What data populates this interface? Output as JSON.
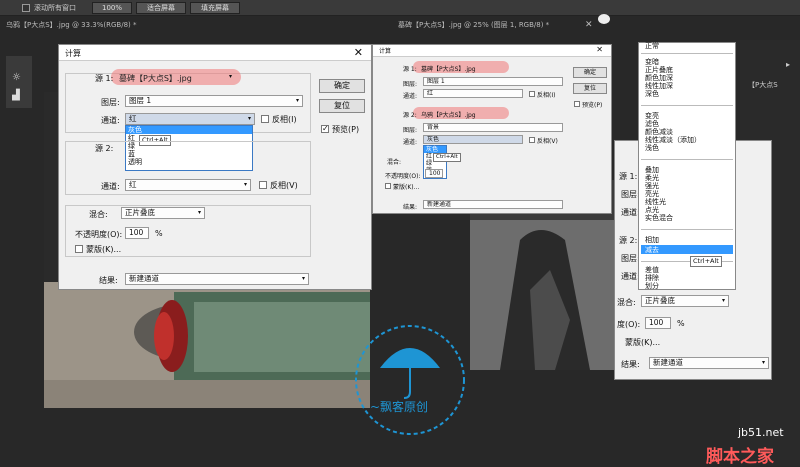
{
  "topbar": {
    "checkbox_label": "滚动所有窗口",
    "zoom_btn": "100%",
    "fit_btn": "适合屏幕",
    "fill_btn": "填充屏幕"
  },
  "tabs": {
    "left": "乌鸦【P大点S】.jpg @ 33.3%(RGB/8) *",
    "right": "墓碑【P大点S】.jpg @ 25% (图层 1, RGB/8) *"
  },
  "calc_big": {
    "title": "计算",
    "source1_label": "源 1:",
    "source1_value": "墓碑【P大点S】.jpg",
    "layer_label": "图层:",
    "layer_value": "图层 1",
    "channel_label": "通道:",
    "channel_value": "红",
    "invert_label": "反相(I)",
    "channel_options": [
      "灰色",
      "红",
      "绿",
      "蓝",
      "透明"
    ],
    "tooltip": "Ctrl+Alt",
    "source2_label": "源 2:",
    "channel2_label": "通道:",
    "channel2_value": "红",
    "invert2_label": "反相(V)",
    "blend_label": "混合:",
    "blend_value": "正片叠底",
    "opacity_label": "不透明度(O):",
    "opacity_value": "100",
    "opacity_unit": "%",
    "mask_label": "蒙版(K)...",
    "result_label": "结果:",
    "result_value": "新建通道",
    "ok_btn": "确定",
    "reset_btn": "复位",
    "preview_label": "预览(P)"
  },
  "calc_small": {
    "title": "计算",
    "source1_label": "源 1:",
    "source1_value": "墓碑【P大点S】.jpg",
    "layer_label": "图层:",
    "layer_value": "图层 1",
    "channel_label": "通道:",
    "channel_value": "红",
    "invert_label": "反相(I)",
    "source2_label": "源 2:",
    "source2_value": "乌鸦【P大点S】.jpg",
    "layer2_label": "图层:",
    "layer2_value": "背景",
    "channel2_label": "通道:",
    "channel2_value": "灰色",
    "invert2_label": "反相(V)",
    "channel_options": [
      "灰色",
      "红",
      "绿",
      "蓝"
    ],
    "tooltip": "Ctrl+Alt",
    "blend_label": "混合:",
    "opacity_label": "不透明度(O):",
    "opacity_value": "100",
    "mask_label": "蒙版(K)...",
    "result_label": "结果:",
    "result_value": "新建通道",
    "ok_btn": "确定",
    "reset_btn": "复位",
    "preview_label": "预览(P)"
  },
  "calc_right": {
    "source1_label": "源 1:",
    "layer_label": "图层:",
    "channel_label": "通道:",
    "source2_label": "源 2:",
    "layer2_label": "图层:",
    "channel2_label": "通道:",
    "blend_label": "混合:",
    "blend_value": "正片叠底",
    "opacity_label": "度(O):",
    "opacity_value": "100",
    "opacity_unit": "%",
    "mask_label": "蒙版(K)...",
    "result_label": "结果:",
    "result_value": "新建通道"
  },
  "blend_menu": {
    "items_top": [
      "正常"
    ],
    "group1": [
      "变暗",
      "正片叠底",
      "颜色加深",
      "线性加深",
      "深色"
    ],
    "group2": [
      "变亮",
      "滤色",
      "颜色减淡",
      "线性减淡（添加）",
      "浅色"
    ],
    "group3": [
      "叠加",
      "柔光",
      "强光",
      "亮光",
      "线性光",
      "点光",
      "实色混合"
    ],
    "group4": [
      "相加",
      "减去"
    ],
    "group5": [
      "差值",
      "排除",
      "划分"
    ],
    "selected": "减去",
    "tooltip": "Ctrl+Alt"
  },
  "watermark": {
    "text": "~飘客原创",
    "site": "jb51.net",
    "brand": "脚本之家"
  },
  "right_panel_text": "【P大点S"
}
